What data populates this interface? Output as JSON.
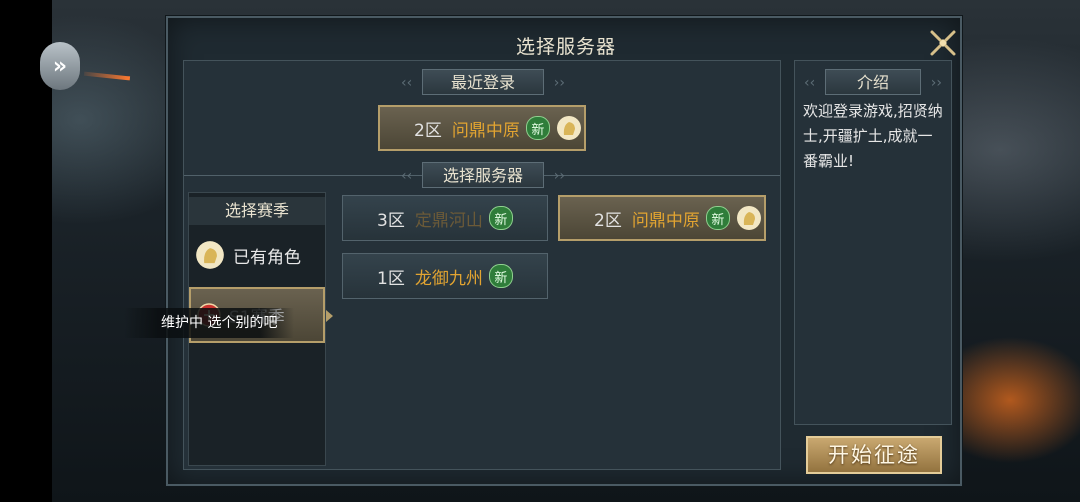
{
  "dialog": {
    "title": "选择服务器",
    "close_icon": "close-x-icon"
  },
  "recent": {
    "header": "最近登录",
    "server": {
      "zone": "2区",
      "name": "问鼎中原",
      "badge": "新",
      "has_role_icon": "character-head-icon"
    }
  },
  "select": {
    "header": "选择服务器",
    "servers": [
      {
        "zone": "3区",
        "name": "定鼎河山",
        "badge": "新",
        "state": "maintenance"
      },
      {
        "zone": "2区",
        "name": "问鼎中原",
        "badge": "新",
        "state": "selected",
        "has_role_icon": "character-head-icon"
      },
      {
        "zone": "1区",
        "name": "龙御九州",
        "badge": "新",
        "state": "normal"
      }
    ]
  },
  "seasons": {
    "title": "选择赛季",
    "items": [
      {
        "label": "已有角色",
        "icon": "character-head-icon"
      },
      {
        "label": "S1赛季",
        "icon": "red-season-icon",
        "selected": true
      }
    ]
  },
  "tooltip": "维护中 选个别的吧",
  "intro": {
    "header": "介绍",
    "text": "欢迎登录游戏,招贤纳士,开疆扩土,成就一番霸业!"
  },
  "start_button": "开始征途",
  "colors": {
    "accent_gold": "#e2a431",
    "selected_border": "#b59e6a",
    "new_badge": "#2f7d3a"
  }
}
